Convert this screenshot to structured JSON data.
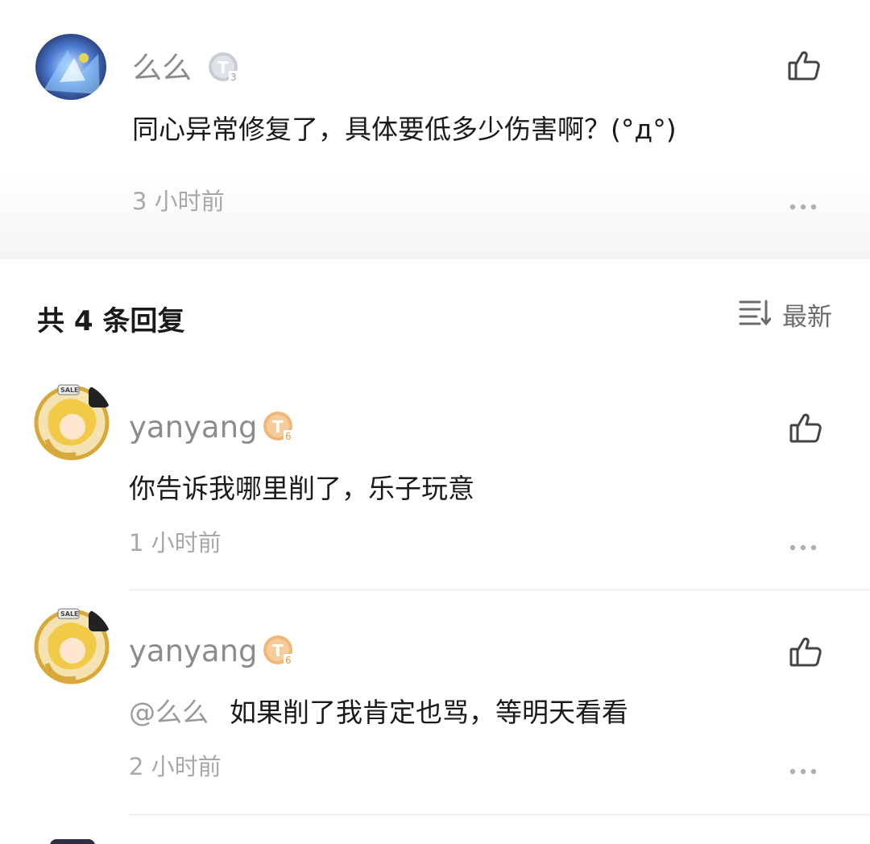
{
  "main_comment": {
    "user": "么么",
    "level": "3",
    "text": "同心异常修复了，具体要低多少伤害啊？(°д°)",
    "time": "3 小时前"
  },
  "replies_header": {
    "title": "共 4 条回复",
    "sort_label": "最新"
  },
  "replies": [
    {
      "user": "yanyang",
      "level": "6",
      "mention": "",
      "text": "你告诉我哪里削了，乐子玩意",
      "time": "1 小时前"
    },
    {
      "user": "yanyang",
      "level": "6",
      "mention": "@么么",
      "text": "如果削了我肯定也骂，等明天看看",
      "time": "2 小时前"
    }
  ],
  "colors": {
    "badge_silver": "#c9ccd3",
    "badge_gold": "#f0b878",
    "text_muted": "#a8a8a8"
  }
}
